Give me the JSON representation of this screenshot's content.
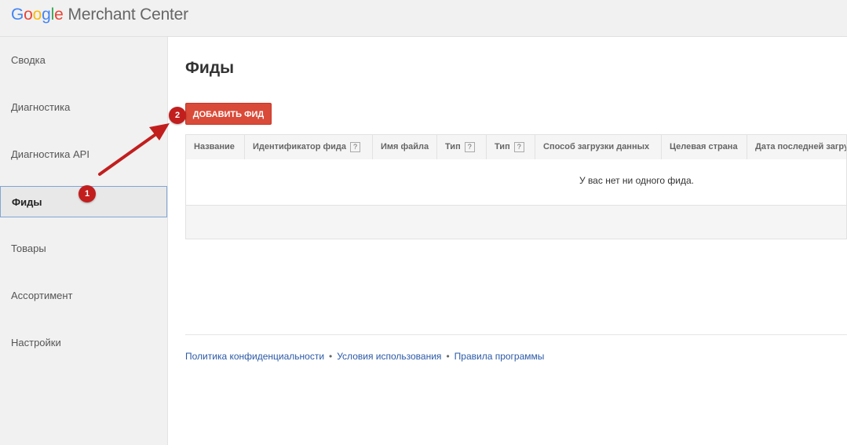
{
  "app": {
    "logo_letters": [
      "G",
      "o",
      "o",
      "g",
      "l",
      "e"
    ],
    "product": "Merchant Center"
  },
  "sidebar": {
    "items": [
      {
        "label": "Сводка",
        "active": false
      },
      {
        "label": "Диагностика",
        "active": false
      },
      {
        "label": "Диагностика API",
        "active": false
      },
      {
        "label": "Фиды",
        "active": true
      },
      {
        "label": "Товары",
        "active": false
      },
      {
        "label": "Ассортимент",
        "active": false
      },
      {
        "label": "Настройки",
        "active": false
      }
    ]
  },
  "main": {
    "title": "Фиды",
    "add_button": "ДОБАВИТЬ ФИД",
    "table": {
      "columns": [
        {
          "label": "Название",
          "help": ""
        },
        {
          "label": "Идентификатор фида",
          "help": "?"
        },
        {
          "label": "Имя файла",
          "help": ""
        },
        {
          "label": "Тип",
          "help": "?"
        },
        {
          "label": "Тип",
          "help": "?"
        },
        {
          "label": "Способ загрузки данных",
          "help": ""
        },
        {
          "label": "Целевая страна",
          "help": ""
        },
        {
          "label": "Дата последней загрузки",
          "help": ""
        }
      ],
      "empty_message": "У вас нет ни одного фида."
    }
  },
  "footer": {
    "links": [
      "Политика конфиденциальности",
      "Условия использования",
      "Правила программы"
    ],
    "separator": "•"
  },
  "annotations": {
    "badge_1": "1",
    "badge_2": "2"
  },
  "colors": {
    "accent_button": "#d94a38",
    "annotation_red": "#c21e1e",
    "link": "#2b59a6"
  }
}
